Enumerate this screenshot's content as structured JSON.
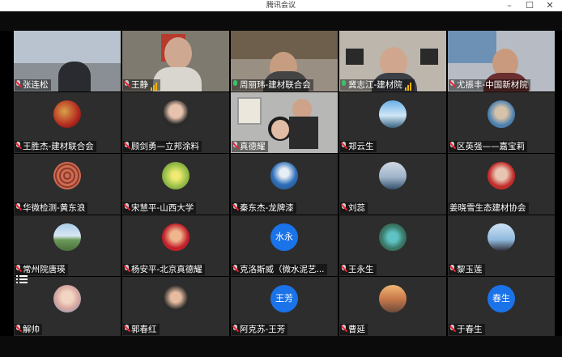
{
  "window": {
    "title": "腾讯会议",
    "min": "–",
    "max": "☐",
    "close": "✕"
  },
  "tiles": [
    {
      "name": "张连松",
      "mic": "off"
    },
    {
      "name": "王静",
      "mic": "off",
      "signal": true
    },
    {
      "name": "周丽玮-建材联合会",
      "mic": "on"
    },
    {
      "name": "冀志江-建材院",
      "mic": "on",
      "signal": true
    },
    {
      "name": "尤振丰-中国新材院",
      "mic": "off"
    },
    {
      "name": "王胜杰-建材联合会",
      "mic": "off"
    },
    {
      "name": "顾剑勇—立邦涂料",
      "mic": "off"
    },
    {
      "name": "真德耀",
      "mic": "off"
    },
    {
      "name": "郑云生",
      "mic": "off"
    },
    {
      "name": "区英强——嘉宝莉",
      "mic": "off"
    },
    {
      "name": "华微检测-黄东浪",
      "mic": "off"
    },
    {
      "name": "宋慧平-山西大学",
      "mic": "off"
    },
    {
      "name": "秦东杰-龙牌漆",
      "mic": "off"
    },
    {
      "name": "刘蕊",
      "mic": "off"
    },
    {
      "name": "姜晓雪生态建材协会",
      "mic": "none"
    },
    {
      "name": "常州院唐瑛",
      "mic": "off"
    },
    {
      "name": "杨安平-北京真德耀",
      "mic": "off"
    },
    {
      "name": "克洛斯威（微水泥艺...",
      "mic": "off",
      "avatar_text": "水永"
    },
    {
      "name": "王永生",
      "mic": "off"
    },
    {
      "name": "黎玉莲",
      "mic": "off"
    },
    {
      "name": "解帅",
      "mic": "off"
    },
    {
      "name": "郭春红",
      "mic": "off"
    },
    {
      "name": "阿克苏-王芳",
      "mic": "off",
      "avatar_text": "王芳"
    },
    {
      "name": "曹延",
      "mic": "off"
    },
    {
      "name": "于春生",
      "mic": "off",
      "avatar_text": "春生"
    }
  ],
  "menu_icon": "list-menu-icon",
  "colors": {
    "tile_bg": "#2d2d2d",
    "avatar_blue": "#1a73e8",
    "mic_off": "#e23",
    "mic_on": "#3ec06b"
  }
}
